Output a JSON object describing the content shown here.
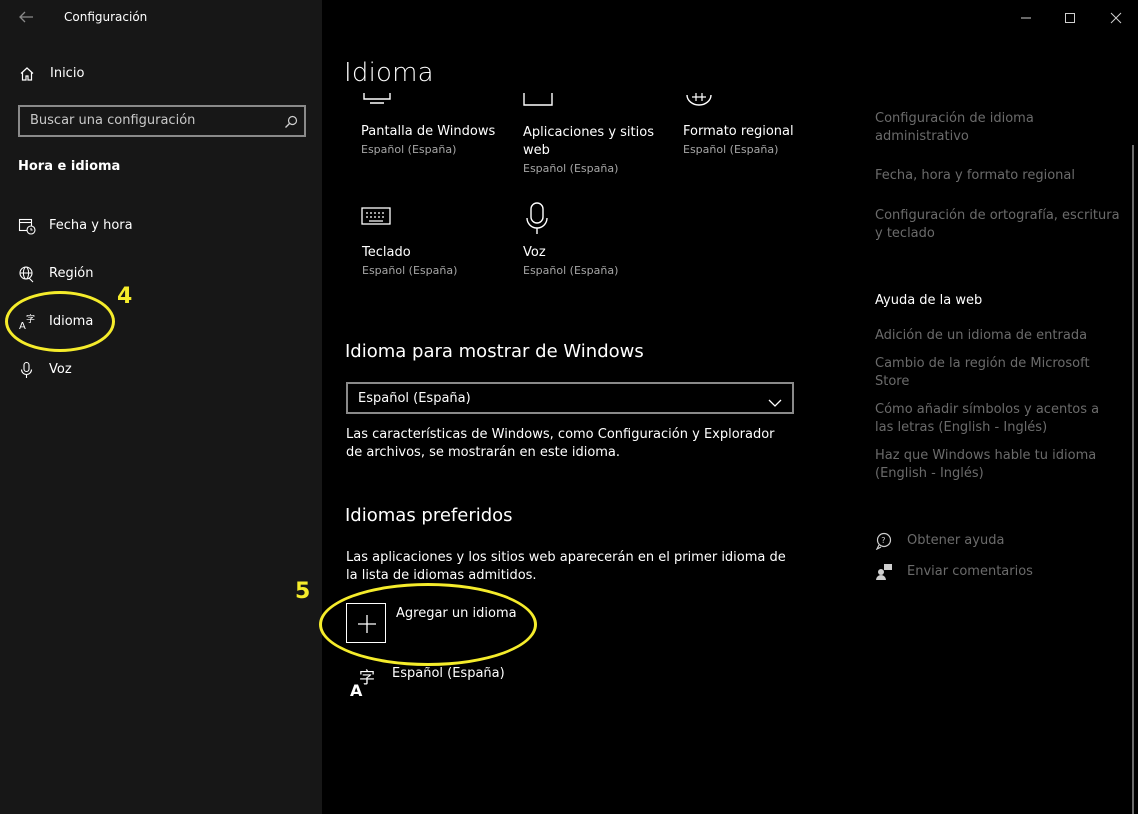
{
  "window": {
    "title": "Configuración"
  },
  "sidebar": {
    "home_label": "Inicio",
    "search_placeholder": "Buscar una configuración",
    "section_title": "Hora e idioma",
    "items": [
      {
        "label": "Fecha y hora",
        "icon": "calendar-clock-icon"
      },
      {
        "label": "Región",
        "icon": "globe-icon"
      },
      {
        "label": "Idioma",
        "icon": "language-icon"
      },
      {
        "label": "Voz",
        "icon": "microphone-icon"
      }
    ]
  },
  "main": {
    "title": "Idioma",
    "tiles": [
      {
        "name": "Pantalla de Windows",
        "sub": "Español (España)"
      },
      {
        "name": "Aplicaciones y sitios web",
        "sub": "Español (España)"
      },
      {
        "name": "Formato regional",
        "sub": "Español (España)"
      },
      {
        "name": "Teclado",
        "sub": "Español (España)"
      },
      {
        "name": "Voz",
        "sub": "Español (España)"
      }
    ],
    "display_language": {
      "heading": "Idioma para mostrar de Windows",
      "selected": "Español (España)",
      "description": "Las características de Windows, como Configuración y Explorador de archivos, se mostrarán en este idioma."
    },
    "preferred": {
      "heading": "Idiomas preferidos",
      "description": "Las aplicaciones y los sitios web aparecerán en el primer idioma de la lista de idiomas admitidos.",
      "add_label": "Agregar un idioma",
      "languages": [
        "Español (España)"
      ]
    }
  },
  "related": {
    "links": [
      "Configuración de idioma administrativo",
      "Fecha, hora y formato regional",
      "Configuración de ortografía, escritura y teclado"
    ],
    "web_help_heading": "Ayuda de la web",
    "web_links": [
      "Adición de un idioma de entrada",
      "Cambio de la región de Microsoft Store",
      "Cómo añadir símbolos y acentos a las letras (English - Inglés)",
      "Haz que Windows hable tu idioma (English - Inglés)"
    ],
    "get_help": "Obtener ayuda",
    "feedback": "Enviar comentarios"
  },
  "annotations": {
    "step_4": "4",
    "step_5": "5",
    "color": "#f5ec2b"
  },
  "colors": {
    "sidebar_bg": "#171717",
    "main_bg": "#000000",
    "muted_text": "#6b6b6b"
  }
}
